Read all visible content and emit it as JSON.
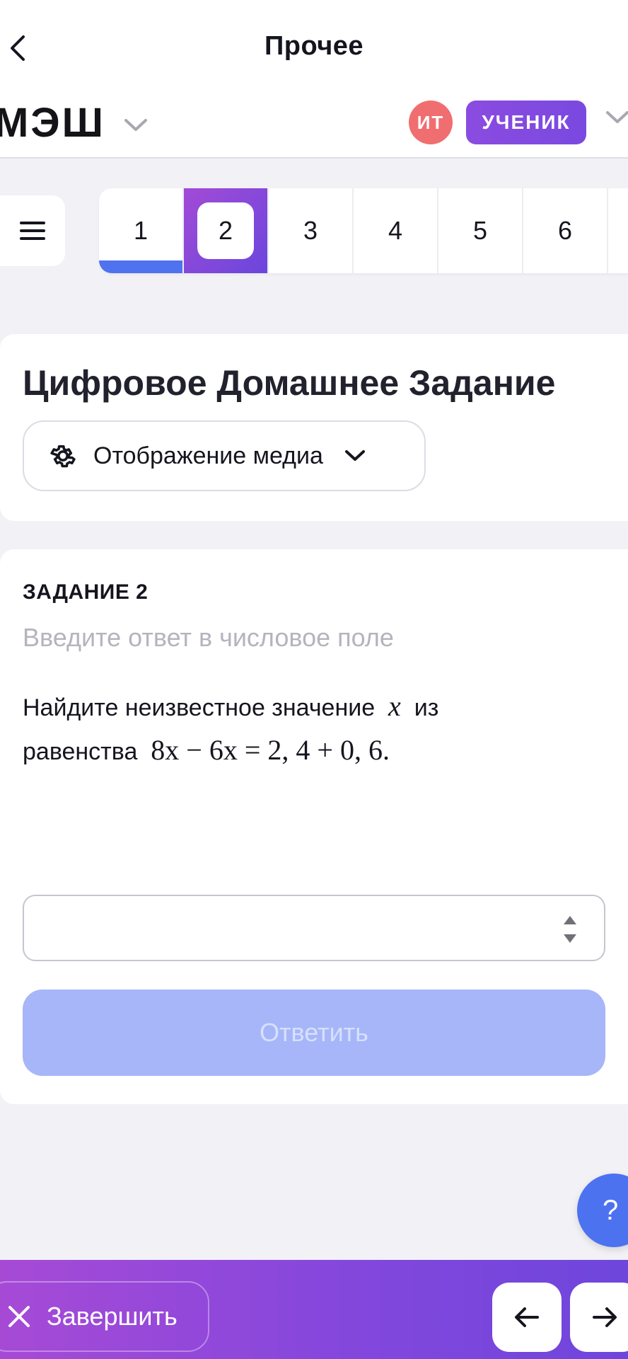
{
  "navbar": {
    "title": "Прочее"
  },
  "header": {
    "brand": "МЭШ",
    "avatar_initials": "ИТ",
    "role": "УЧЕНИК"
  },
  "tasks": {
    "items": [
      "1",
      "2",
      "3",
      "4",
      "5",
      "6"
    ],
    "completed": [
      "1"
    ],
    "active": "2"
  },
  "title_card": {
    "title": "Цифровое Домашнее Задание",
    "media_button": "Отображение медиа"
  },
  "question": {
    "label": "ЗАДАНИЕ 2",
    "hint": "Введите ответ в числовое поле",
    "text_before": "Найдите неизвестное значение",
    "variable": "x",
    "text_mid": "из",
    "text_line2": "равенства",
    "equation": "8x − 6x = 2, 4 + 0, 6.",
    "answer_value": "",
    "submit_label": "Ответить"
  },
  "help": {
    "label": "?"
  },
  "footer": {
    "finish_label": "Завершить"
  },
  "colors": {
    "accent_blue": "#4f72ef",
    "accent_purple": "#8b4be0",
    "avatar_red": "#f16e70",
    "submit_disabled": "#a6b6f8"
  }
}
